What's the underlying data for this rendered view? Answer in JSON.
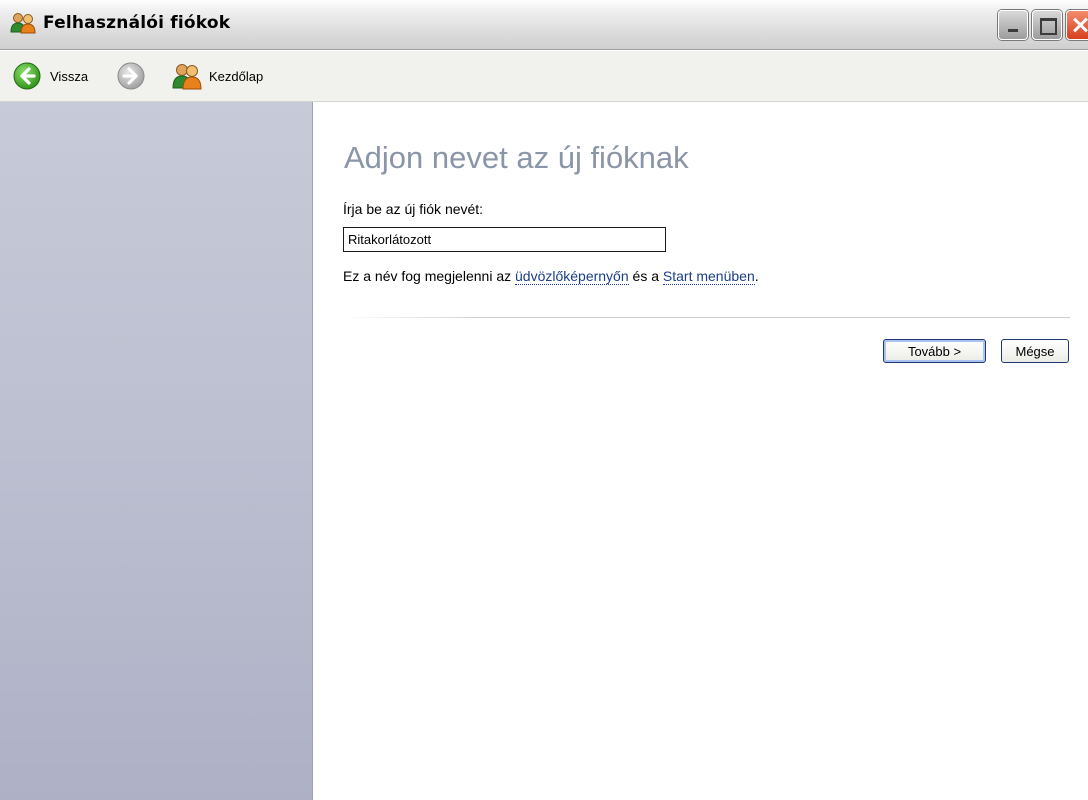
{
  "window": {
    "title": "Felhasználói fiókok",
    "controls": {
      "minimize": "minimize",
      "maximize": "maximize",
      "close": "close"
    }
  },
  "toolbar": {
    "back_label": "Vissza",
    "forward_label": "",
    "home_label": "Kezdőlap"
  },
  "main": {
    "heading": "Adjon nevet az új fióknak",
    "field_label": "Írja be az új fiók nevét:",
    "field_value": "Ritakorlátozott",
    "hint_prefix": "Ez a név fog megjelenni az ",
    "hint_link1": "üdvözlőképernyőn",
    "hint_middle": " és a ",
    "hint_link2": "Start menüben",
    "hint_suffix": ".",
    "next_button": "Tovább >",
    "cancel_button": "Mégse"
  },
  "colors": {
    "heading": "#8a95a8",
    "link": "#1a3e8a",
    "sidebar_top": "#c7cad8",
    "sidebar_bottom": "#aeb1c6",
    "back_arrow": "#3aa61e",
    "forward_arrow": "#a8a8a8"
  },
  "icons": {
    "title": "users-icon",
    "back": "back-arrow-icon",
    "forward": "forward-arrow-icon",
    "home": "users-icon"
  }
}
